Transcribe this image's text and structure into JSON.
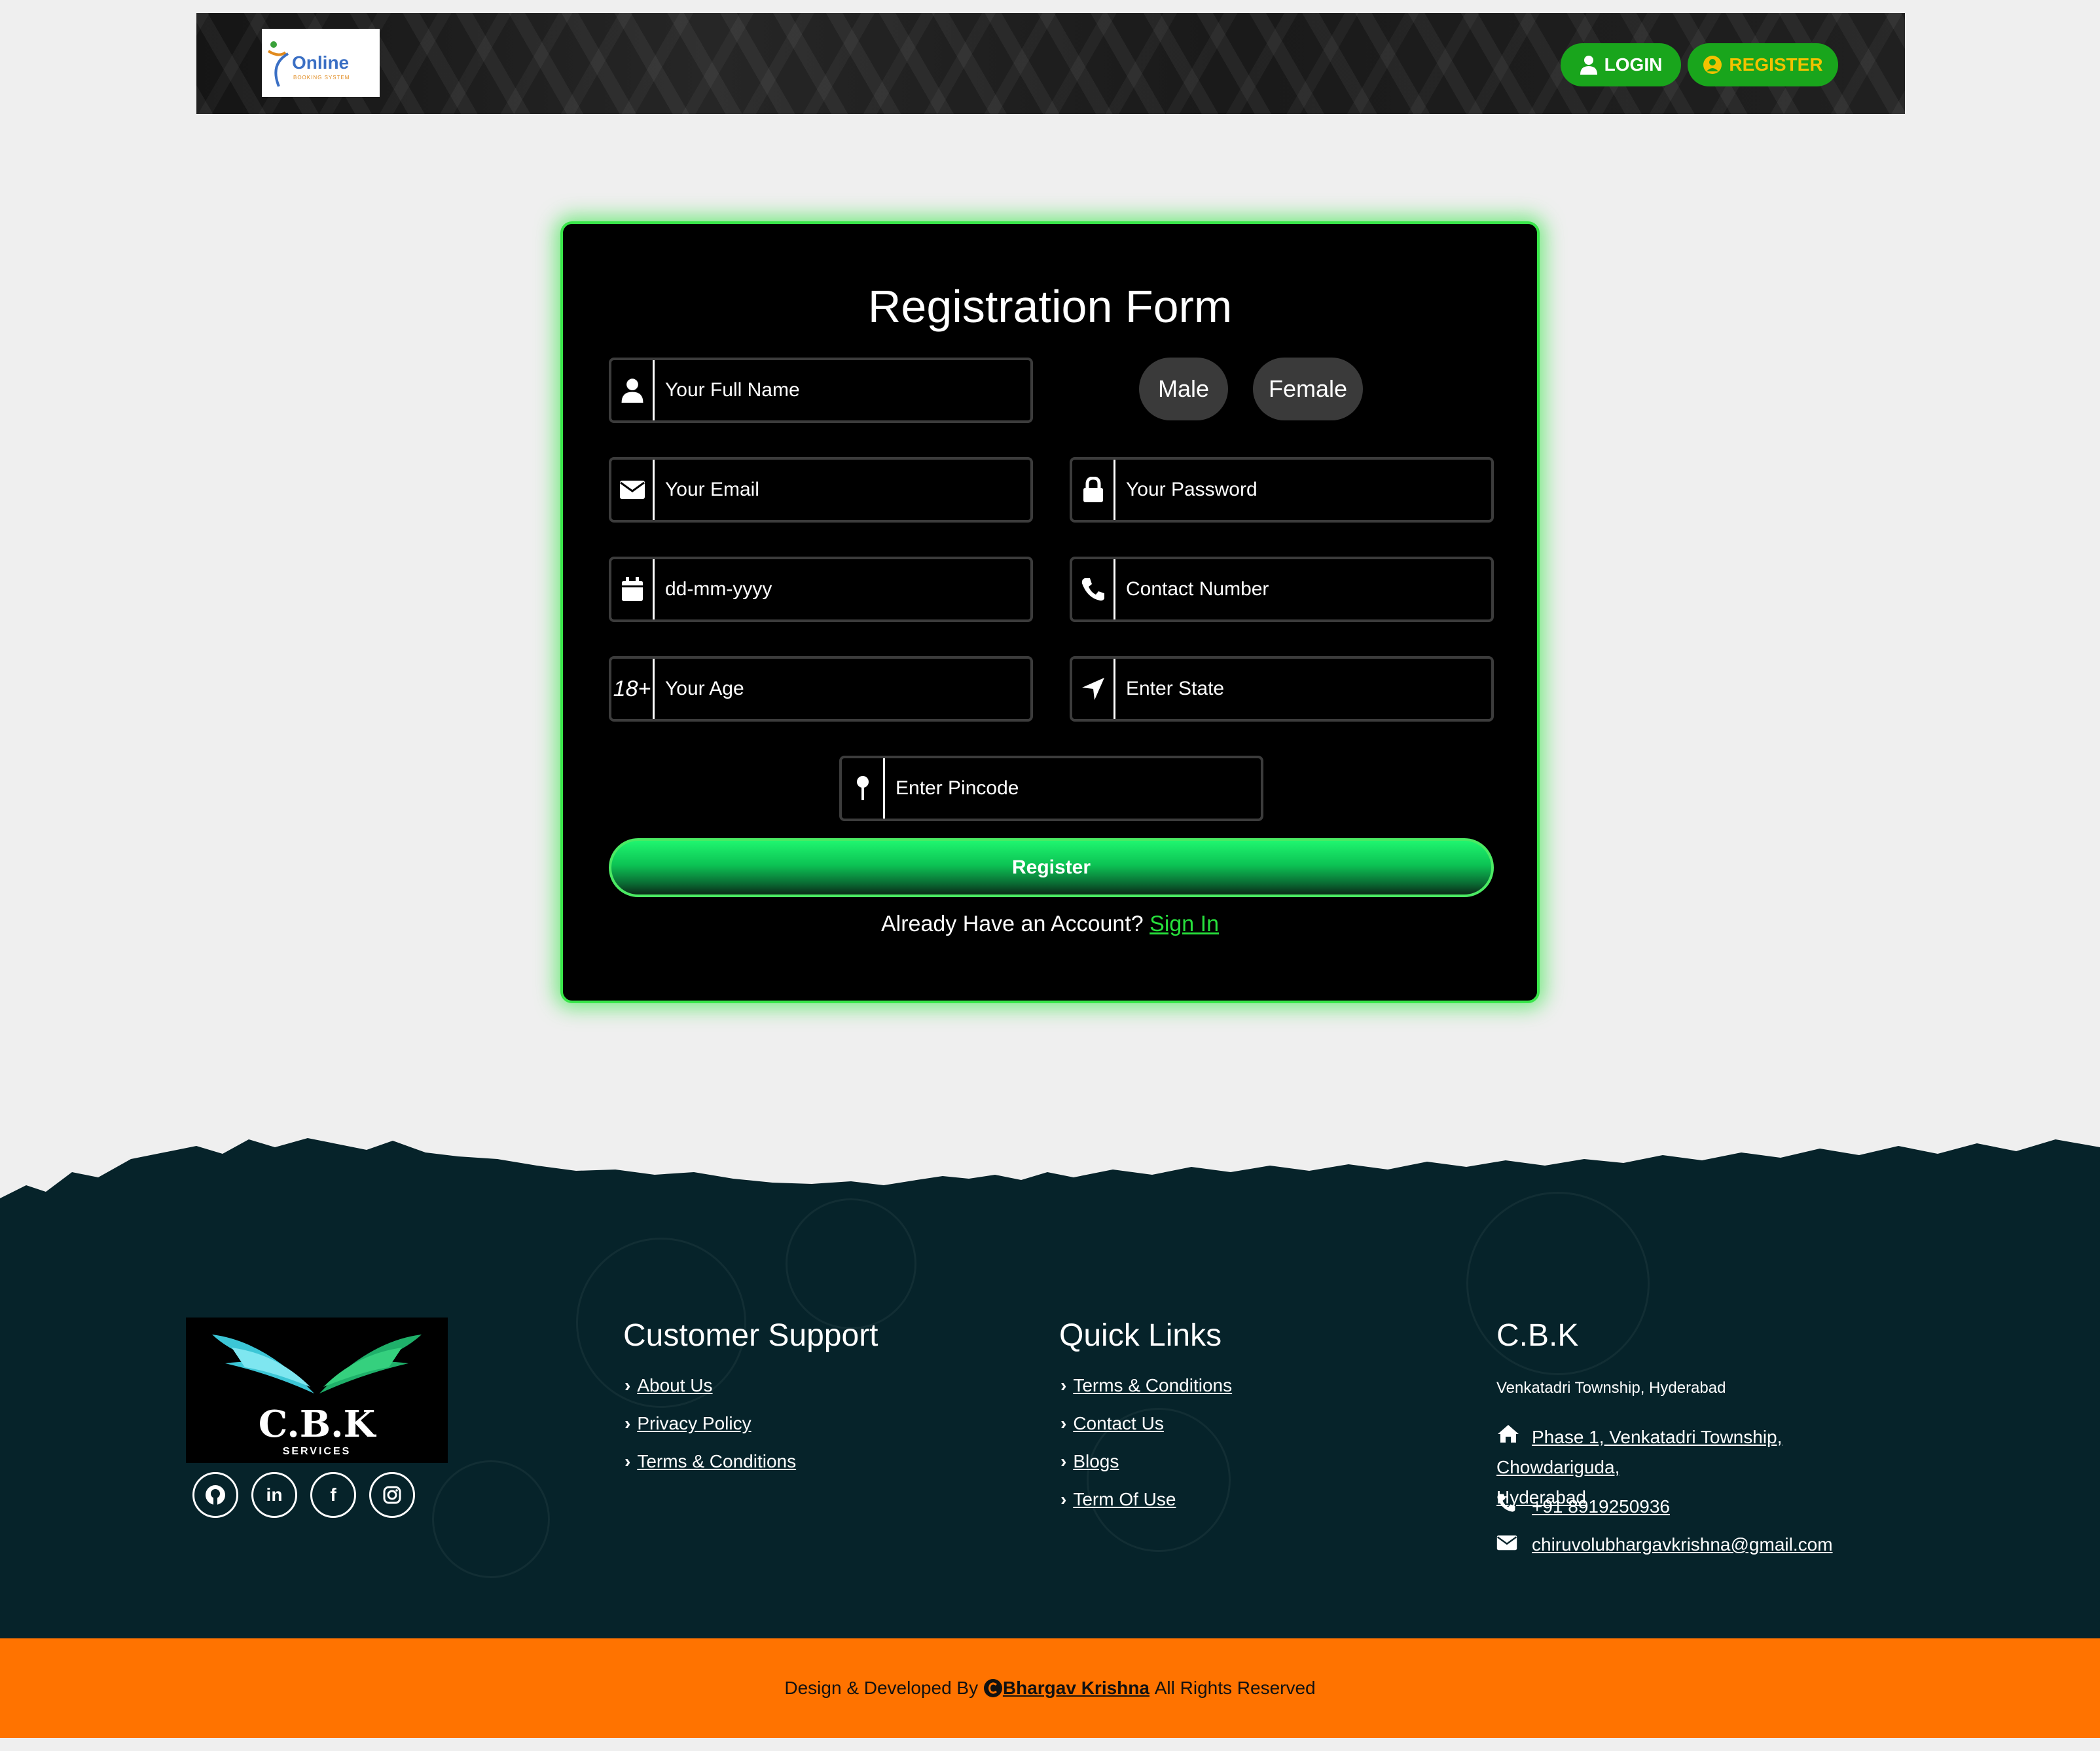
{
  "header": {
    "logo_text": "Online",
    "logo_subtext": "BOOKING SYSTEM",
    "login_label": "LOGIN",
    "register_label": "REGISTER",
    "accent_color": "#19a51c"
  },
  "form": {
    "title": "Registration Form",
    "full_name_placeholder": "Your Full Name",
    "gender_options": [
      "Male",
      "Female"
    ],
    "email_placeholder": "Your Email",
    "password_placeholder": "Your Password",
    "dob_placeholder": "dd-mm-yyyy",
    "contact_placeholder": "Contact Number",
    "age_icon_text": "18+",
    "age_placeholder": "Your Age",
    "state_placeholder": "Enter State",
    "pincode_placeholder": "Enter Pincode",
    "submit_label": "Register",
    "account_prompt": "Already Have an Account?",
    "signin_label": "Sign In",
    "glow_color": "#39e64a"
  },
  "footer": {
    "brand_name": "C.B.K",
    "brand_tagline": "SERVICES",
    "social_icons": [
      "github-icon",
      "linkedin-icon",
      "facebook-icon",
      "instagram-icon"
    ],
    "support": {
      "title": "Customer Support",
      "links": [
        "About Us",
        "Privacy Policy",
        "Terms & Conditions"
      ]
    },
    "quick": {
      "title": "Quick Links",
      "links": [
        "Terms & Conditions",
        "Contact Us",
        "Blogs",
        "Term Of Use"
      ]
    },
    "company": {
      "title": "C.B.K",
      "location": "Venkatadri Township, Hyderabad",
      "address_line1": "Phase 1, Venkatadri Township, Chowdariguda,",
      "address_line2": "Hyderabad",
      "phone": "+91 8919250936",
      "email": "chiruvolubhargavkrishna@gmail.com"
    },
    "background_color": "#06232a"
  },
  "copyright": {
    "prefix": "Design & Developed By",
    "author": "Bhargav Krishna",
    "suffix": "All Rights Reserved",
    "bar_color": "#ff7300"
  }
}
